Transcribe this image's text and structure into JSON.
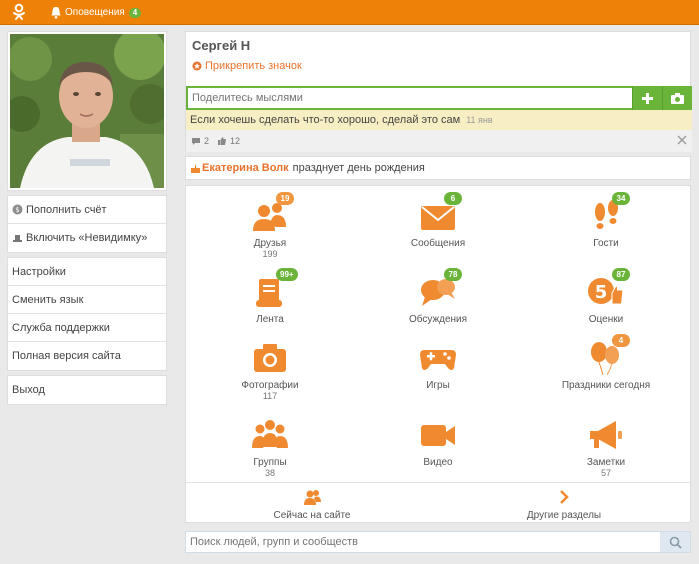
{
  "colors": {
    "accent": "#ee8208",
    "green": "#6bb43a",
    "icon_orange": "#f08a30"
  },
  "topbar": {
    "notifications_label": "Оповещения",
    "notifications_count": "4"
  },
  "sidebar": {
    "top_items": [
      {
        "label": "Пополнить счёт",
        "icon": "coin-icon"
      },
      {
        "label": "Включить «Невидимку»",
        "icon": "hat-icon"
      }
    ],
    "settings_items": [
      "Настройки",
      "Сменить язык",
      "Служба поддержки",
      "Полная версия сайта"
    ],
    "logout": "Выход"
  },
  "profile": {
    "name": "Сергей Н",
    "pin_label": "Прикрепить значок",
    "post_placeholder": "Поделитесь мыслями",
    "status_text": "Если хочешь сделать что-то хорошо, сделай это сам",
    "status_date": "11 янв",
    "comments_count": "2",
    "likes_count": "12"
  },
  "birthday": {
    "name": "Екатерина Волк",
    "text": "празднует день рождения"
  },
  "sections": [
    {
      "label": "Друзья",
      "sub": "199",
      "badge": "19",
      "badge_color": "orange",
      "icon": "friends-icon"
    },
    {
      "label": "Сообщения",
      "sub": "",
      "badge": "6",
      "badge_color": "green",
      "icon": "envelope-icon"
    },
    {
      "label": "Гости",
      "sub": "",
      "badge": "34",
      "badge_color": "green",
      "icon": "footprints-icon"
    },
    {
      "label": "Лента",
      "sub": "",
      "badge": "99+",
      "badge_color": "green",
      "icon": "scroll-icon"
    },
    {
      "label": "Обсуждения",
      "sub": "",
      "badge": "78",
      "badge_color": "green",
      "icon": "chat-bubbles-icon"
    },
    {
      "label": "Оценки",
      "sub": "",
      "badge": "87",
      "badge_color": "green",
      "icon": "rating-five-icon"
    },
    {
      "label": "Фотографии",
      "sub": "117",
      "badge": "",
      "badge_color": "",
      "icon": "camera-icon"
    },
    {
      "label": "Игры",
      "sub": "",
      "badge": "",
      "badge_color": "",
      "icon": "gamepad-icon"
    },
    {
      "label": "Праздники сегодня",
      "sub": "",
      "badge": "4",
      "badge_color": "orange",
      "icon": "balloons-icon"
    },
    {
      "label": "Группы",
      "sub": "38",
      "badge": "",
      "badge_color": "",
      "icon": "groups-icon"
    },
    {
      "label": "Видео",
      "sub": "",
      "badge": "",
      "badge_color": "",
      "icon": "video-camera-icon"
    },
    {
      "label": "Заметки",
      "sub": "57",
      "badge": "",
      "badge_color": "",
      "icon": "megaphone-icon"
    }
  ],
  "bottom": {
    "online_label": "Сейчас на сайте",
    "other_label": "Другие разделы"
  },
  "search": {
    "placeholder": "Поиск людей, групп и сообществ"
  }
}
